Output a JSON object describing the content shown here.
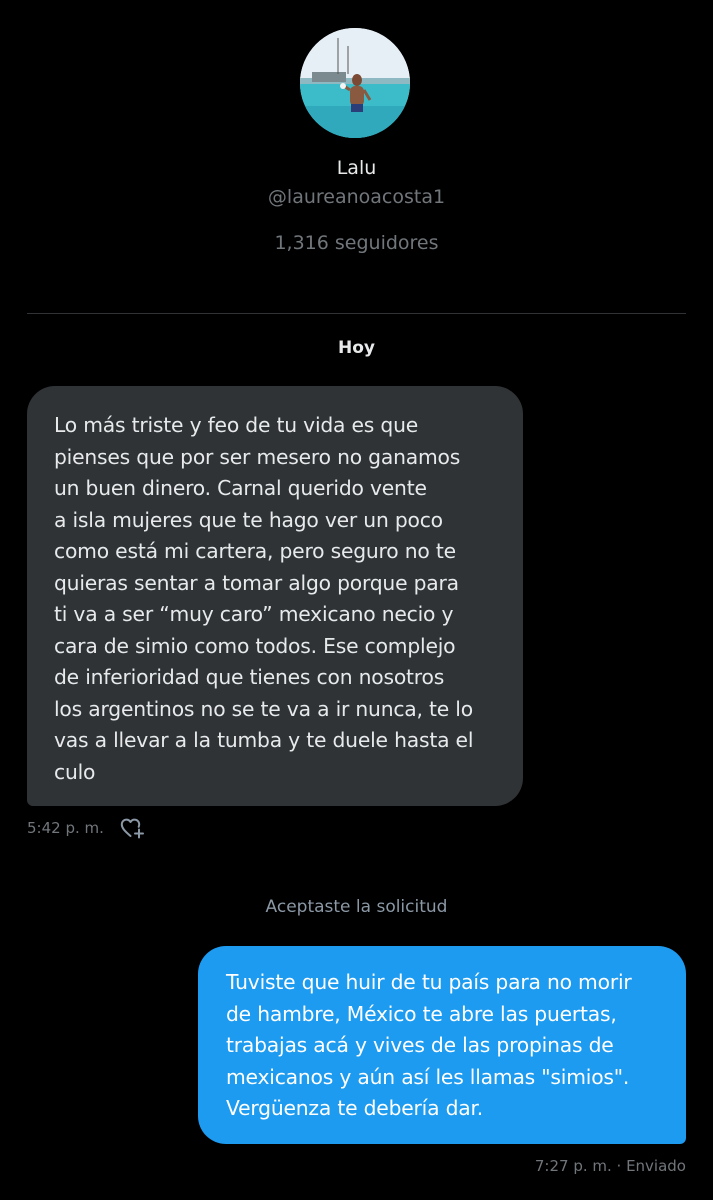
{
  "profile": {
    "name": "Lalu",
    "handle": "@laureanoacosta1",
    "followers": "1,316 seguidores"
  },
  "conversation": {
    "date_label": "Hoy",
    "received_message": {
      "text": "Lo más triste y feo de tu vida es que\npienses que por ser mesero no ganamos\nun buen dinero. Carnal querido vente\na isla mujeres que te hago ver un poco\ncomo está mi cartera, pero seguro no te\nquieras sentar a tomar algo porque para\nti va a ser “muy caro” mexicano necio y\ncara de simio como todos. Ese complejo\nde inferioridad que tienes con nosotros\nlos argentinos no se te va a ir nunca, te lo\nvas a llevar a la tumba y te duele hasta el\nculo",
      "time": "5:42 p. m.",
      "reaction_icon": "heart-plus-icon"
    },
    "system_message": "Aceptaste la solicitud",
    "sent_message": {
      "text": "Tuviste que huir de tu país para no morir\nde hambre, México te abre las puertas,\ntrabajas acá y vives de las propinas de\nmexicanos y aún así les llamas \"simios\".\nVergüenza te debería dar.",
      "status": "7:27 p. m. · Enviado"
    }
  },
  "colors": {
    "background": "#000000",
    "received_bubble": "#2f3336",
    "sent_bubble": "#1d9bf0",
    "secondary_text": "#71767b"
  }
}
